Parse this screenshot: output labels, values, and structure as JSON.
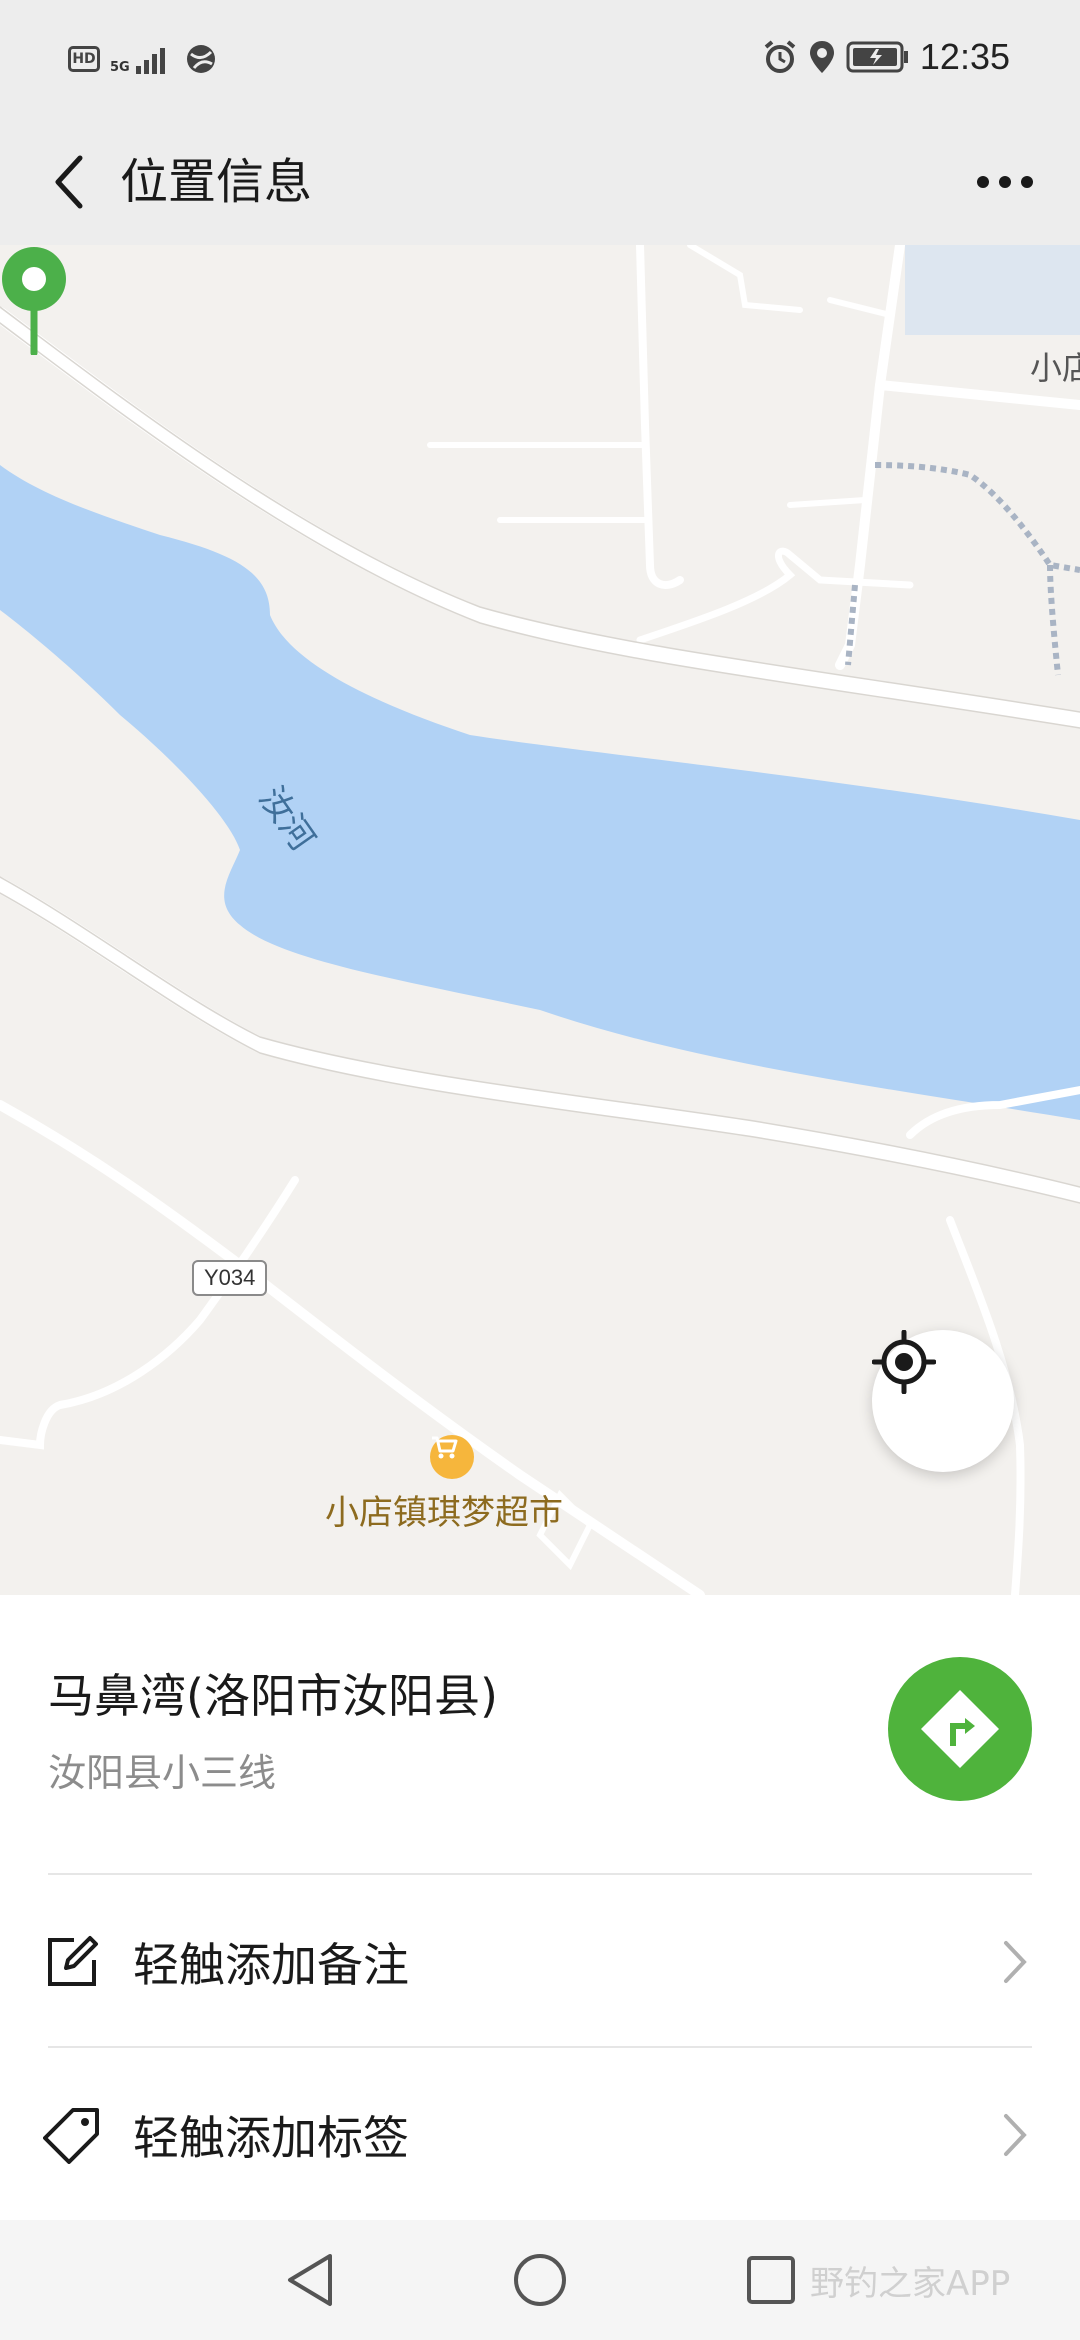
{
  "status_bar": {
    "hd_label": "HD",
    "network_label": "5G",
    "time": "12:35"
  },
  "nav": {
    "title": "位置信息"
  },
  "map": {
    "river_label": "汝河",
    "road_badge": "Y034",
    "poi_label": "小店镇琪梦超市",
    "corner_label": "小店",
    "colors": {
      "land": "#f3f1ee",
      "water": "#b1d2f5",
      "road": "#ffffff",
      "pin": "#4cb04a"
    }
  },
  "place": {
    "name": "马鼻湾(洛阳市汝阳县)",
    "address": "汝阳县小三线"
  },
  "actions": [
    {
      "label": "轻触添加备注",
      "icon": "edit-note-icon"
    },
    {
      "label": "轻触添加标签",
      "icon": "tag-icon"
    }
  ],
  "watermark": "野钓之家APP"
}
